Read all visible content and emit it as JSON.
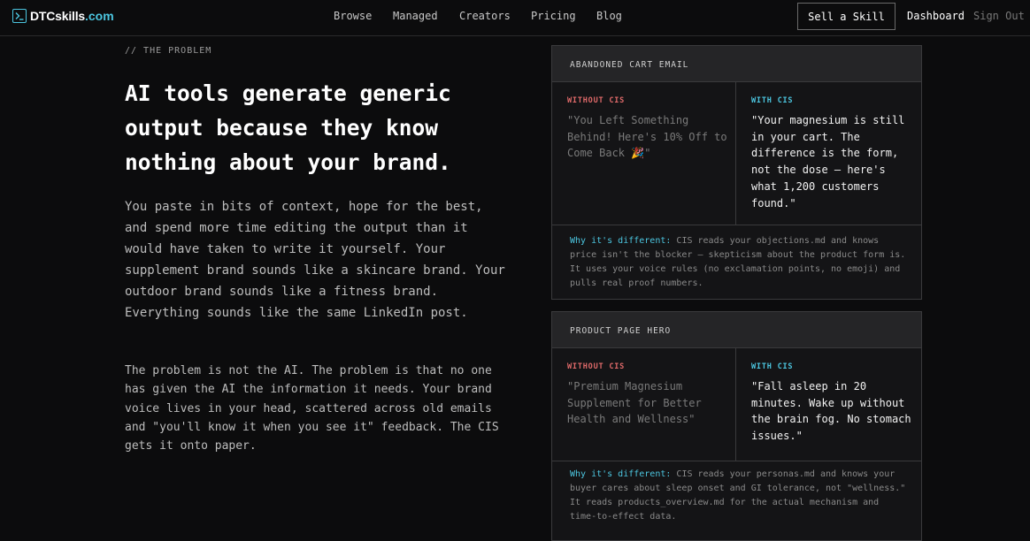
{
  "nav": {
    "logo_text": "DTCskills",
    "logo_tld": ".com",
    "links": [
      "Browse",
      "Managed",
      "Creators",
      "Pricing",
      "Blog"
    ],
    "sell_label": "Sell a Skill",
    "dashboard_label": "Dashboard",
    "signout_label": "Sign Out"
  },
  "hero": {
    "eyebrow": "// THE PROBLEM",
    "headline": "AI tools generate generic output because they know nothing about your brand.",
    "paragraph1": "You paste in bits of context, hope for the best, and spend more time editing the output than it would have taken to write it yourself. Your supplement brand sounds like a skincare brand. Your outdoor brand sounds like a fitness brand. Everything sounds like the same LinkedIn post.",
    "paragraph2": "The problem is not the AI. The problem is that no one has given the AI the information it needs. Your brand voice lives in your head, scattered across old emails and \"you'll know it when you see it\" feedback. The CIS gets it onto paper."
  },
  "cards": [
    {
      "title": "ABANDONED CART EMAIL",
      "without_label": "WITHOUT CIS",
      "without_text": "\"You Left Something Behind! Here's 10% Off to Come Back 🎉\"",
      "with_label": "WITH CIS",
      "with_text": "\"Your magnesium is still in your cart. The difference is the form, not the dose — here's what 1,200 customers found.\"",
      "why_label": "Why it's different:",
      "why_text": "CIS reads your objections.md and knows price isn't the blocker — skepticism about the product form is. It uses your voice rules (no exclamation points, no emoji) and pulls real proof numbers."
    },
    {
      "title": "PRODUCT PAGE HERO",
      "without_label": "WITHOUT CIS",
      "without_text": "\"Premium Magnesium Supplement for Better Health and Wellness\"",
      "with_label": "WITH CIS",
      "with_text": "\"Fall asleep in 20 minutes. Wake up without the brain fog. No stomach issues.\"",
      "why_label": "Why it's different:",
      "why_text": "CIS reads your personas.md and knows your buyer cares about sleep onset and GI tolerance, not \"wellness.\" It reads products_overview.md for the actual mechanism and time-to-effect data."
    }
  ],
  "colors": {
    "accent": "#4cc6e0",
    "without": "#e06a6a",
    "background": "#0c0c0d"
  }
}
